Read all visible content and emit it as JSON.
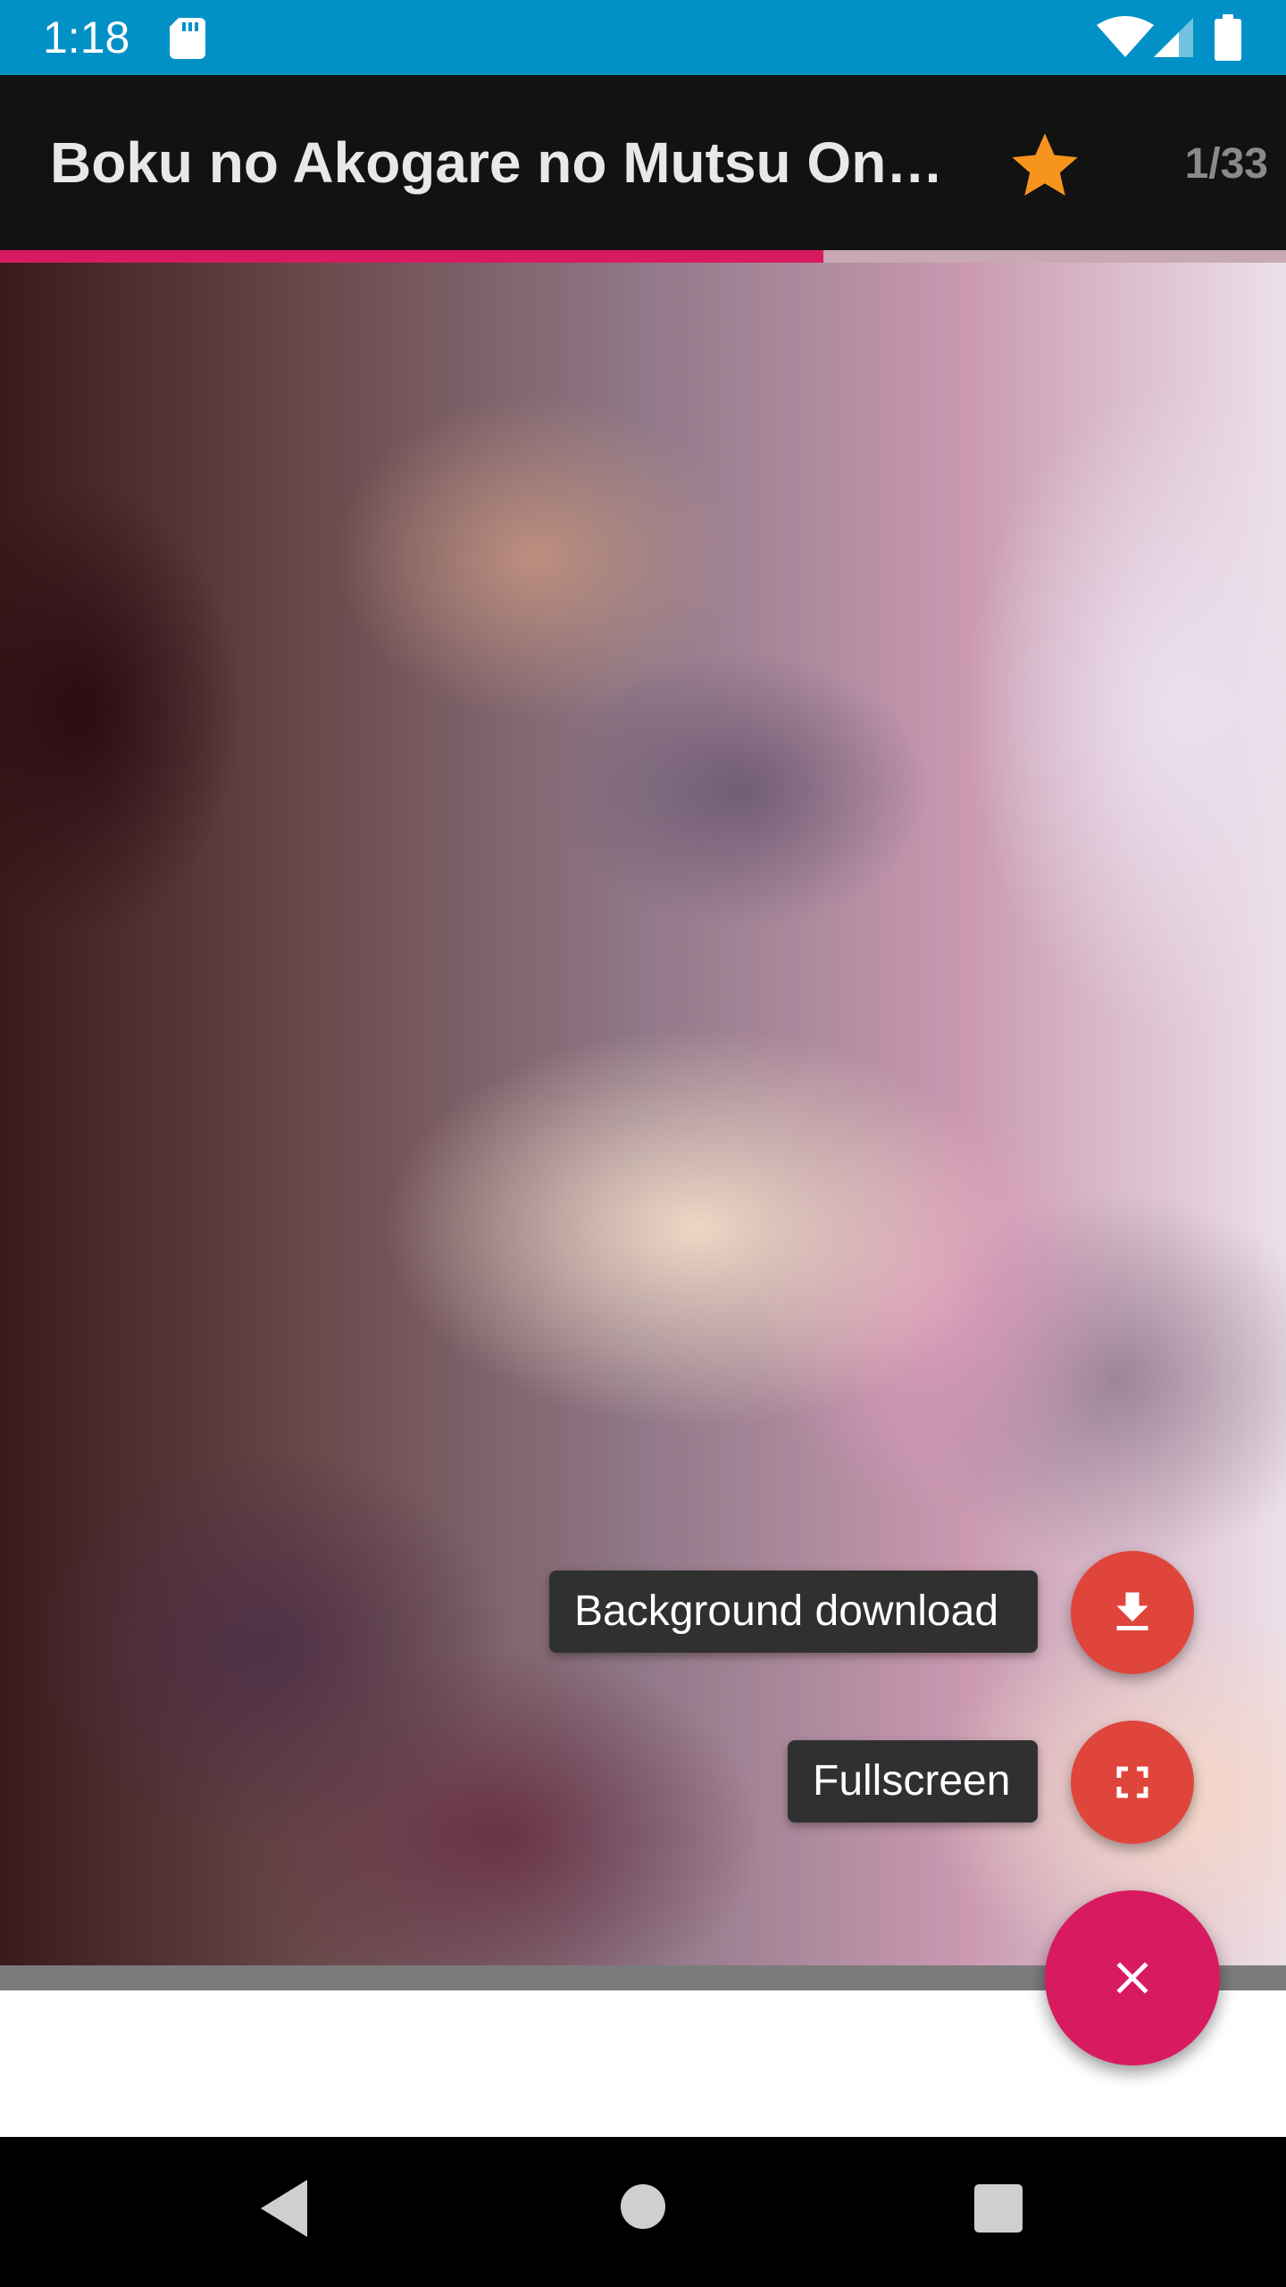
{
  "status_bar": {
    "time": "1:18",
    "icons": [
      "sd-card-icon",
      "wifi-icon",
      "cell-signal-icon",
      "battery-icon"
    ],
    "background": "#0191c6"
  },
  "toolbar": {
    "title": "Boku no Akogare no Mutsu Onee-san",
    "favorite_icon": "star-icon",
    "favorite_color": "#f7941d",
    "page_counter": "1/33",
    "background": "#121212"
  },
  "reading_progress": {
    "fraction": 0.64,
    "fill_color": "#d81b60"
  },
  "fab_menu": {
    "background_download_label": "Background download",
    "background_download_icon": "download-icon",
    "fullscreen_label": "Fullscreen",
    "fullscreen_icon": "fullscreen-icon",
    "close_icon": "close-icon",
    "mini_fab_color": "#e0453c",
    "main_fab_color": "#d81b60"
  },
  "nav_bar": {
    "icons": [
      "back-icon",
      "home-icon",
      "recents-icon"
    ]
  }
}
